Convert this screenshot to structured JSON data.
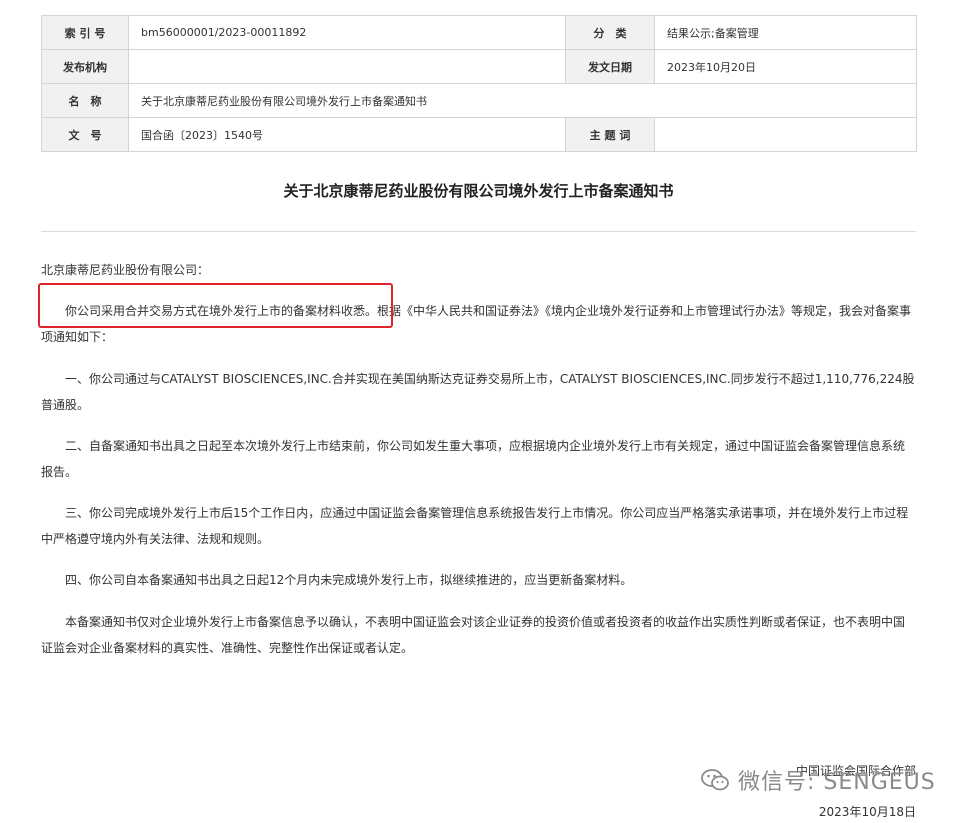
{
  "meta": {
    "index_label": "索 引 号",
    "index_value": "bm56000001/2023-00011892",
    "category_label": "分　类",
    "category_value": "结果公示;备案管理",
    "publisher_label": "发布机构",
    "publisher_value": "",
    "date_label": "发文日期",
    "date_value": "2023年10月20日",
    "name_label": "名　称",
    "name_value": "关于北京康蒂尼药业股份有限公司境外发行上市备案通知书",
    "doc_no_label": "文　号",
    "doc_no_value": "国合函〔2023〕1540号",
    "keywords_label": "主 题 词",
    "keywords_value": ""
  },
  "title": "关于北京康蒂尼药业股份有限公司境外发行上市备案通知书",
  "salutation": "北京康蒂尼药业股份有限公司：",
  "paragraphs": [
    "你公司采用合并交易方式在境外发行上市的备案材料收悉。根据《中华人民共和国证券法》《境内企业境外发行证券和上市管理试行办法》等规定，我会对备案事项通知如下：",
    "一、你公司通过与CATALYST BIOSCIENCES,INC.合并实现在美国纳斯达克证券交易所上市，CATALYST BIOSCIENCES,INC.同步发行不超过1,110,776,224股普通股。",
    "二、自备案通知书出具之日起至本次境外发行上市结束前，你公司如发生重大事项，应根据境内企业境外发行上市有关规定，通过中国证监会备案管理信息系统报告。",
    "三、你公司完成境外发行上市后15个工作日内，应通过中国证监会备案管理信息系统报告发行上市情况。你公司应当严格落实承诺事项，并在境外发行上市过程中严格遵守境内外有关法律、法规和规则。",
    "四、你公司自本备案通知书出具之日起12个月内未完成境外发行上市，拟继续推进的，应当更新备案材料。",
    "本备案通知书仅对企业境外发行上市备案信息予以确认，不表明中国证监会对该企业证券的投资价值或者投资者的收益作出实质性判断或者保证，也不表明中国证监会对企业备案材料的真实性、准确性、完整性作出保证或者认定。"
  ],
  "signature": {
    "org": "中国证监会国际合作部",
    "date": "2023年10月18日"
  },
  "watermark": "微信号: SENGEUS",
  "colors": {
    "highlight": "#e0242c",
    "label_bg": "#f1f1f1",
    "border": "#d4d4d4"
  },
  "icons": {
    "watermark_icon": "wechat-icon"
  }
}
